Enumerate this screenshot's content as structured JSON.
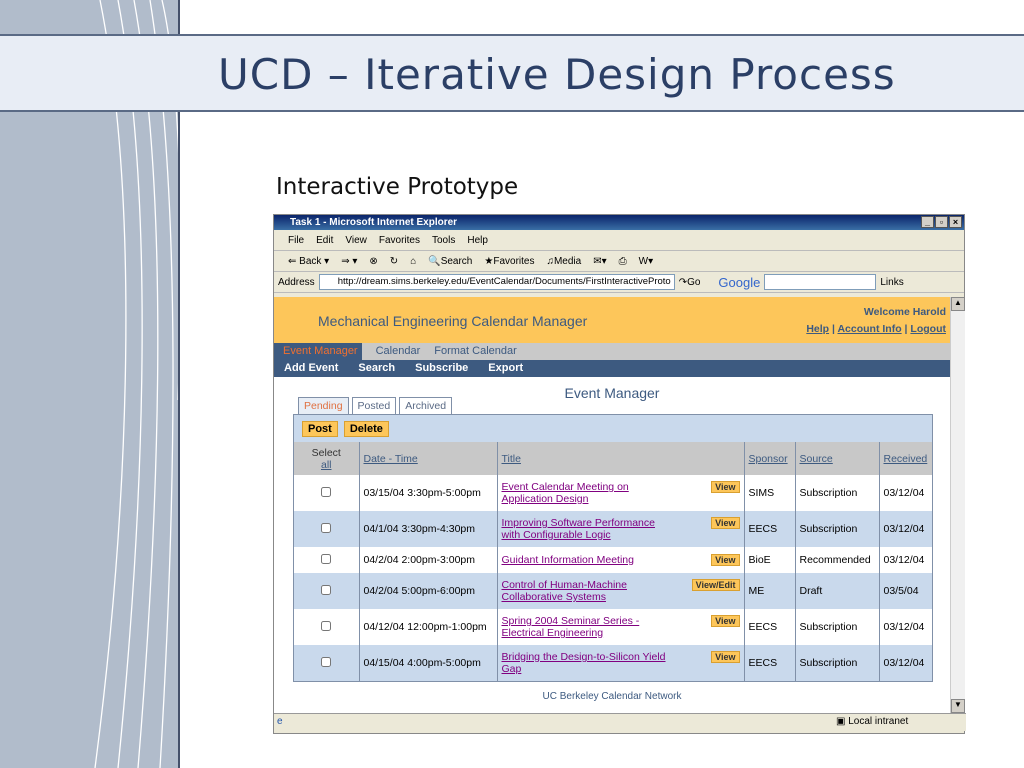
{
  "slide": {
    "title": "UCD – Iterative Design Process",
    "subtitle": "Interactive Prototype"
  },
  "browser": {
    "title": "Task 1 - Microsoft Internet Explorer",
    "menu": [
      "File",
      "Edit",
      "View",
      "Favorites",
      "Tools",
      "Help"
    ],
    "toolbar": {
      "back": "Back",
      "search": "Search",
      "favorites": "Favorites",
      "media": "Media"
    },
    "address_label": "Address",
    "url": "http://dream.sims.berkeley.edu/EventCalendar/Documents/FirstInteractiveProto",
    "go": "Go",
    "google": "Google",
    "links": "Links",
    "status_zone": "Local intranet"
  },
  "app": {
    "name": "Mechanical Engineering Calendar Manager",
    "welcome": "Welcome Harold",
    "help": "Help",
    "account": "Account Info",
    "logout": "Logout",
    "nav": [
      "Event Manager",
      "Calendar",
      "Format Calendar"
    ],
    "subnav": [
      "Add Event",
      "Search",
      "Subscribe",
      "Export"
    ],
    "heading": "Event Manager",
    "tabs": [
      "Pending",
      "Posted",
      "Archived"
    ],
    "post": "Post",
    "delete": "Delete",
    "columns": {
      "select": "Select",
      "all": "all",
      "date": "Date - Time",
      "title": "Title",
      "sponsor": "Sponsor",
      "source": "Source",
      "received": "Received"
    },
    "rows": [
      {
        "date": "03/15/04 3:30pm-5:00pm",
        "title": "Event Calendar Meeting on Application Design",
        "action": "View",
        "sponsor": "SIMS",
        "source": "Subscription",
        "received": "03/12/04"
      },
      {
        "date": "04/1/04 3:30pm-4:30pm",
        "title": "Improving Software Performance with Configurable Logic",
        "action": "View",
        "sponsor": "EECS",
        "source": "Subscription",
        "received": "03/12/04"
      },
      {
        "date": "04/2/04 2:00pm-3:00pm",
        "title": "Guidant Information Meeting",
        "action": "View",
        "sponsor": "BioE",
        "source": "Recommended",
        "received": "03/12/04"
      },
      {
        "date": "04/2/04 5:00pm-6:00pm",
        "title": "Control of Human-Machine Collaborative Systems",
        "action": "View/Edit",
        "sponsor": "ME",
        "source": "Draft",
        "received": "03/5/04"
      },
      {
        "date": "04/12/04 12:00pm-1:00pm",
        "title": "Spring 2004 Seminar Series - Electrical Engineering",
        "action": "View",
        "sponsor": "EECS",
        "source": "Subscription",
        "received": "03/12/04"
      },
      {
        "date": "04/15/04 4:00pm-5:00pm",
        "title": "Bridging the Design-to-Silicon Yield Gap",
        "action": "View",
        "sponsor": "EECS",
        "source": "Subscription",
        "received": "03/12/04"
      }
    ],
    "footer": "UC Berkeley Calendar Network"
  }
}
